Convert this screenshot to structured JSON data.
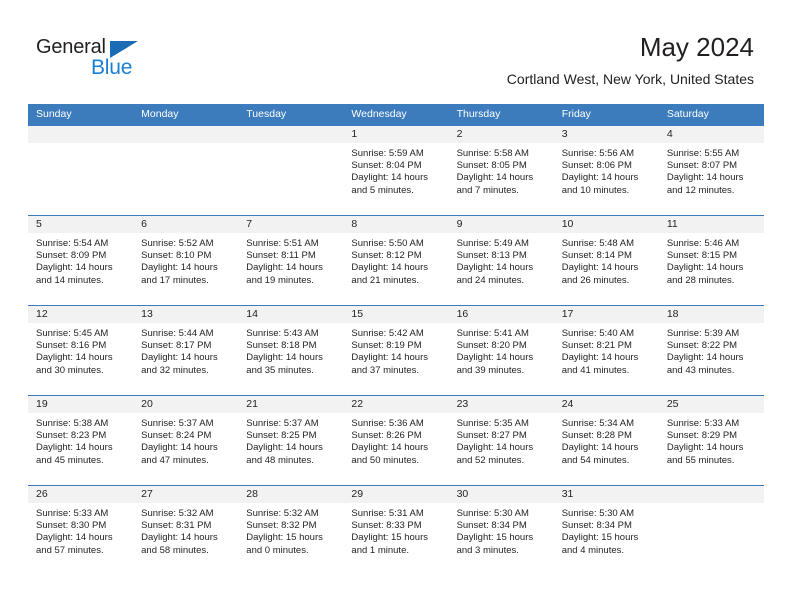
{
  "logo": {
    "word_top": "General",
    "word_bottom": "Blue",
    "triangle_color": "#1b6cb5",
    "blue_text_color": "#1b7fd4"
  },
  "header": {
    "title": "May 2024",
    "subtitle": "Cortland West, New York, United States"
  },
  "colors": {
    "header_band": "#3c7cbd",
    "date_band": "#f2f2f2",
    "text": "#231f20"
  },
  "weekdays": [
    "Sunday",
    "Monday",
    "Tuesday",
    "Wednesday",
    "Thursday",
    "Friday",
    "Saturday"
  ],
  "weeks": [
    [
      {
        "day": "",
        "sunrise": "",
        "sunset": "",
        "daylight_line1": "",
        "daylight_line2": ""
      },
      {
        "day": "",
        "sunrise": "",
        "sunset": "",
        "daylight_line1": "",
        "daylight_line2": ""
      },
      {
        "day": "",
        "sunrise": "",
        "sunset": "",
        "daylight_line1": "",
        "daylight_line2": ""
      },
      {
        "day": "1",
        "sunrise": "Sunrise: 5:59 AM",
        "sunset": "Sunset: 8:04 PM",
        "daylight_line1": "Daylight: 14 hours",
        "daylight_line2": "and 5 minutes."
      },
      {
        "day": "2",
        "sunrise": "Sunrise: 5:58 AM",
        "sunset": "Sunset: 8:05 PM",
        "daylight_line1": "Daylight: 14 hours",
        "daylight_line2": "and 7 minutes."
      },
      {
        "day": "3",
        "sunrise": "Sunrise: 5:56 AM",
        "sunset": "Sunset: 8:06 PM",
        "daylight_line1": "Daylight: 14 hours",
        "daylight_line2": "and 10 minutes."
      },
      {
        "day": "4",
        "sunrise": "Sunrise: 5:55 AM",
        "sunset": "Sunset: 8:07 PM",
        "daylight_line1": "Daylight: 14 hours",
        "daylight_line2": "and 12 minutes."
      }
    ],
    [
      {
        "day": "5",
        "sunrise": "Sunrise: 5:54 AM",
        "sunset": "Sunset: 8:09 PM",
        "daylight_line1": "Daylight: 14 hours",
        "daylight_line2": "and 14 minutes."
      },
      {
        "day": "6",
        "sunrise": "Sunrise: 5:52 AM",
        "sunset": "Sunset: 8:10 PM",
        "daylight_line1": "Daylight: 14 hours",
        "daylight_line2": "and 17 minutes."
      },
      {
        "day": "7",
        "sunrise": "Sunrise: 5:51 AM",
        "sunset": "Sunset: 8:11 PM",
        "daylight_line1": "Daylight: 14 hours",
        "daylight_line2": "and 19 minutes."
      },
      {
        "day": "8",
        "sunrise": "Sunrise: 5:50 AM",
        "sunset": "Sunset: 8:12 PM",
        "daylight_line1": "Daylight: 14 hours",
        "daylight_line2": "and 21 minutes."
      },
      {
        "day": "9",
        "sunrise": "Sunrise: 5:49 AM",
        "sunset": "Sunset: 8:13 PM",
        "daylight_line1": "Daylight: 14 hours",
        "daylight_line2": "and 24 minutes."
      },
      {
        "day": "10",
        "sunrise": "Sunrise: 5:48 AM",
        "sunset": "Sunset: 8:14 PM",
        "daylight_line1": "Daylight: 14 hours",
        "daylight_line2": "and 26 minutes."
      },
      {
        "day": "11",
        "sunrise": "Sunrise: 5:46 AM",
        "sunset": "Sunset: 8:15 PM",
        "daylight_line1": "Daylight: 14 hours",
        "daylight_line2": "and 28 minutes."
      }
    ],
    [
      {
        "day": "12",
        "sunrise": "Sunrise: 5:45 AM",
        "sunset": "Sunset: 8:16 PM",
        "daylight_line1": "Daylight: 14 hours",
        "daylight_line2": "and 30 minutes."
      },
      {
        "day": "13",
        "sunrise": "Sunrise: 5:44 AM",
        "sunset": "Sunset: 8:17 PM",
        "daylight_line1": "Daylight: 14 hours",
        "daylight_line2": "and 32 minutes."
      },
      {
        "day": "14",
        "sunrise": "Sunrise: 5:43 AM",
        "sunset": "Sunset: 8:18 PM",
        "daylight_line1": "Daylight: 14 hours",
        "daylight_line2": "and 35 minutes."
      },
      {
        "day": "15",
        "sunrise": "Sunrise: 5:42 AM",
        "sunset": "Sunset: 8:19 PM",
        "daylight_line1": "Daylight: 14 hours",
        "daylight_line2": "and 37 minutes."
      },
      {
        "day": "16",
        "sunrise": "Sunrise: 5:41 AM",
        "sunset": "Sunset: 8:20 PM",
        "daylight_line1": "Daylight: 14 hours",
        "daylight_line2": "and 39 minutes."
      },
      {
        "day": "17",
        "sunrise": "Sunrise: 5:40 AM",
        "sunset": "Sunset: 8:21 PM",
        "daylight_line1": "Daylight: 14 hours",
        "daylight_line2": "and 41 minutes."
      },
      {
        "day": "18",
        "sunrise": "Sunrise: 5:39 AM",
        "sunset": "Sunset: 8:22 PM",
        "daylight_line1": "Daylight: 14 hours",
        "daylight_line2": "and 43 minutes."
      }
    ],
    [
      {
        "day": "19",
        "sunrise": "Sunrise: 5:38 AM",
        "sunset": "Sunset: 8:23 PM",
        "daylight_line1": "Daylight: 14 hours",
        "daylight_line2": "and 45 minutes."
      },
      {
        "day": "20",
        "sunrise": "Sunrise: 5:37 AM",
        "sunset": "Sunset: 8:24 PM",
        "daylight_line1": "Daylight: 14 hours",
        "daylight_line2": "and 47 minutes."
      },
      {
        "day": "21",
        "sunrise": "Sunrise: 5:37 AM",
        "sunset": "Sunset: 8:25 PM",
        "daylight_line1": "Daylight: 14 hours",
        "daylight_line2": "and 48 minutes."
      },
      {
        "day": "22",
        "sunrise": "Sunrise: 5:36 AM",
        "sunset": "Sunset: 8:26 PM",
        "daylight_line1": "Daylight: 14 hours",
        "daylight_line2": "and 50 minutes."
      },
      {
        "day": "23",
        "sunrise": "Sunrise: 5:35 AM",
        "sunset": "Sunset: 8:27 PM",
        "daylight_line1": "Daylight: 14 hours",
        "daylight_line2": "and 52 minutes."
      },
      {
        "day": "24",
        "sunrise": "Sunrise: 5:34 AM",
        "sunset": "Sunset: 8:28 PM",
        "daylight_line1": "Daylight: 14 hours",
        "daylight_line2": "and 54 minutes."
      },
      {
        "day": "25",
        "sunrise": "Sunrise: 5:33 AM",
        "sunset": "Sunset: 8:29 PM",
        "daylight_line1": "Daylight: 14 hours",
        "daylight_line2": "and 55 minutes."
      }
    ],
    [
      {
        "day": "26",
        "sunrise": "Sunrise: 5:33 AM",
        "sunset": "Sunset: 8:30 PM",
        "daylight_line1": "Daylight: 14 hours",
        "daylight_line2": "and 57 minutes."
      },
      {
        "day": "27",
        "sunrise": "Sunrise: 5:32 AM",
        "sunset": "Sunset: 8:31 PM",
        "daylight_line1": "Daylight: 14 hours",
        "daylight_line2": "and 58 minutes."
      },
      {
        "day": "28",
        "sunrise": "Sunrise: 5:32 AM",
        "sunset": "Sunset: 8:32 PM",
        "daylight_line1": "Daylight: 15 hours",
        "daylight_line2": "and 0 minutes."
      },
      {
        "day": "29",
        "sunrise": "Sunrise: 5:31 AM",
        "sunset": "Sunset: 8:33 PM",
        "daylight_line1": "Daylight: 15 hours",
        "daylight_line2": "and 1 minute."
      },
      {
        "day": "30",
        "sunrise": "Sunrise: 5:30 AM",
        "sunset": "Sunset: 8:34 PM",
        "daylight_line1": "Daylight: 15 hours",
        "daylight_line2": "and 3 minutes."
      },
      {
        "day": "31",
        "sunrise": "Sunrise: 5:30 AM",
        "sunset": "Sunset: 8:34 PM",
        "daylight_line1": "Daylight: 15 hours",
        "daylight_line2": "and 4 minutes."
      },
      {
        "day": "",
        "sunrise": "",
        "sunset": "",
        "daylight_line1": "",
        "daylight_line2": ""
      }
    ]
  ]
}
